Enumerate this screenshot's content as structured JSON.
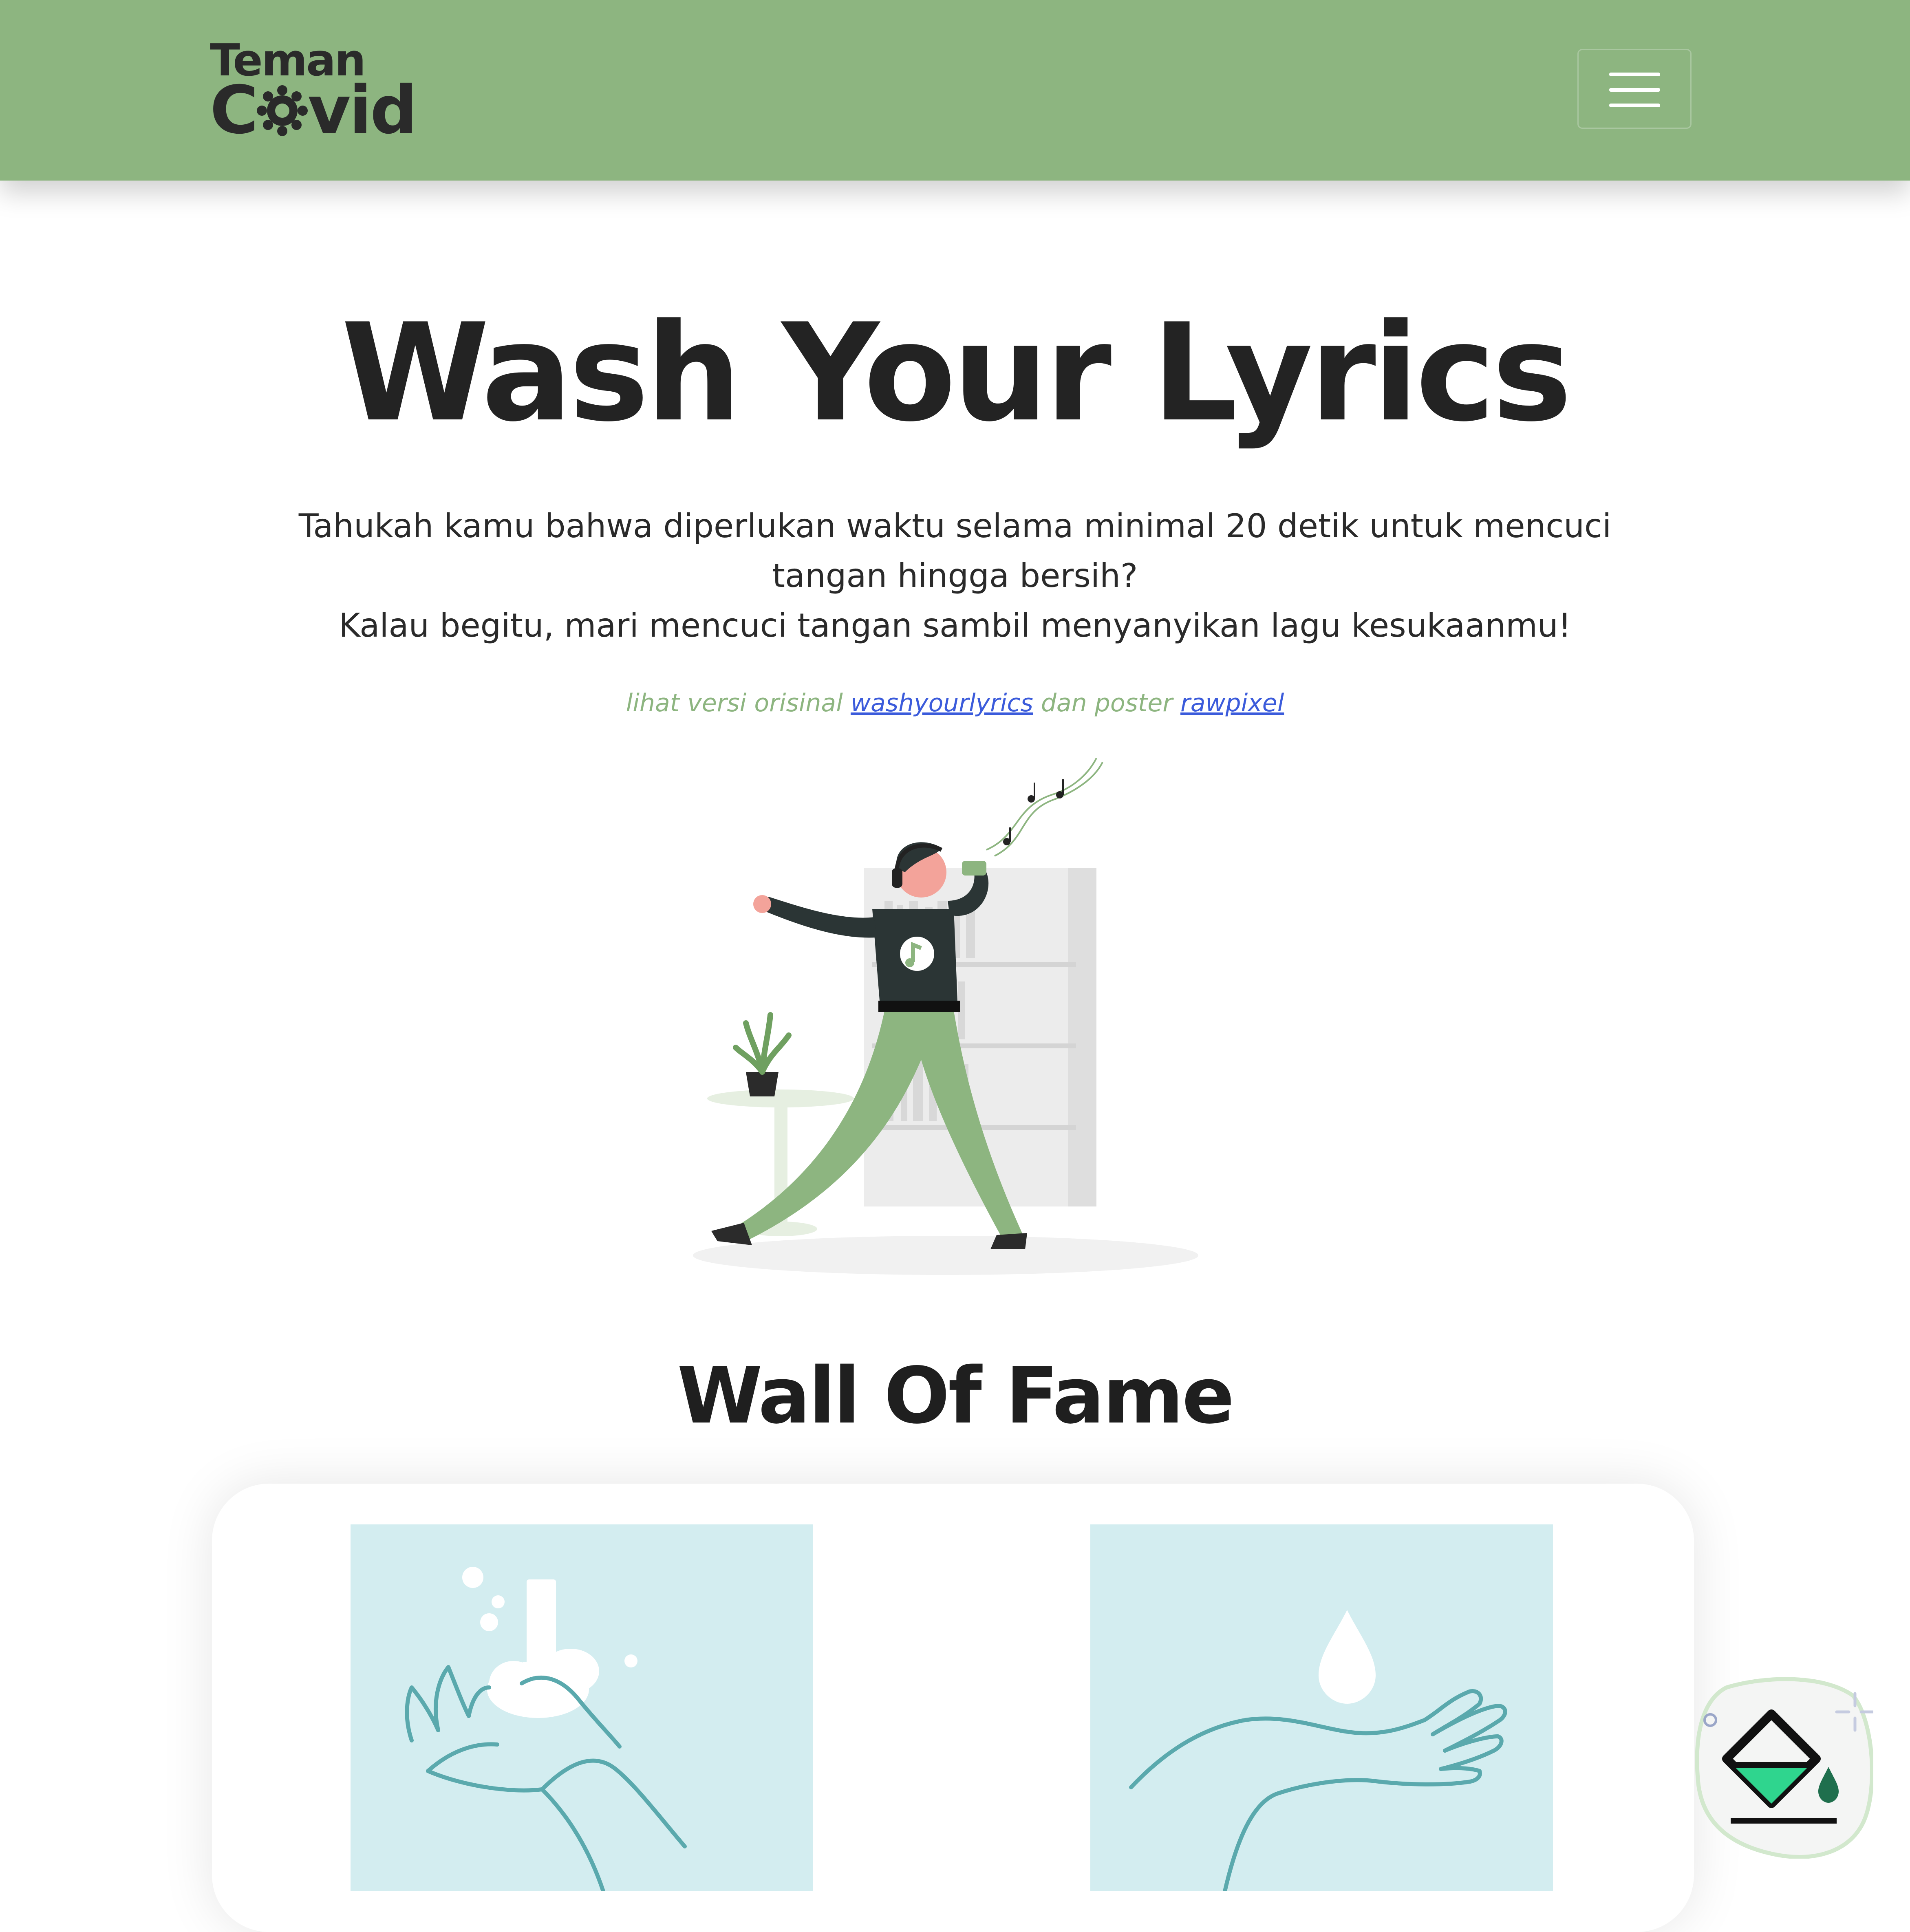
{
  "navbar": {
    "brand_top": "Teman",
    "brand_bottom_left": "C",
    "brand_bottom_right": "vid",
    "menu_icon": "hamburger-icon",
    "background": "#8db580"
  },
  "hero": {
    "title": "Wash Your Lyrics",
    "intro_line1": "Tahukah kamu bahwa diperlukan waktu selama minimal 20 detik untuk mencuci tangan hingga bersih?",
    "intro_line2": "Kalau begitu, mari mencuci tangan sambil menyanyikan lagu kesukaanmu!",
    "credit_prefix": "lihat versi orisinal",
    "credit_link1": "washyourlyrics",
    "credit_middle": "dan poster",
    "credit_link2": "rawpixel"
  },
  "wall_of_fame": {
    "title": "Wall Of Fame",
    "tiles": [
      {
        "icon": "hand-washing-icon"
      },
      {
        "icon": "water-drop-hand-icon"
      }
    ]
  },
  "floating_button": {
    "icon": "paint-bucket-icon"
  },
  "colors": {
    "accent": "#8db580",
    "tile_bg": "#d3edf0",
    "tile_line": "#5aa9ad",
    "link": "#3b5bdb"
  }
}
